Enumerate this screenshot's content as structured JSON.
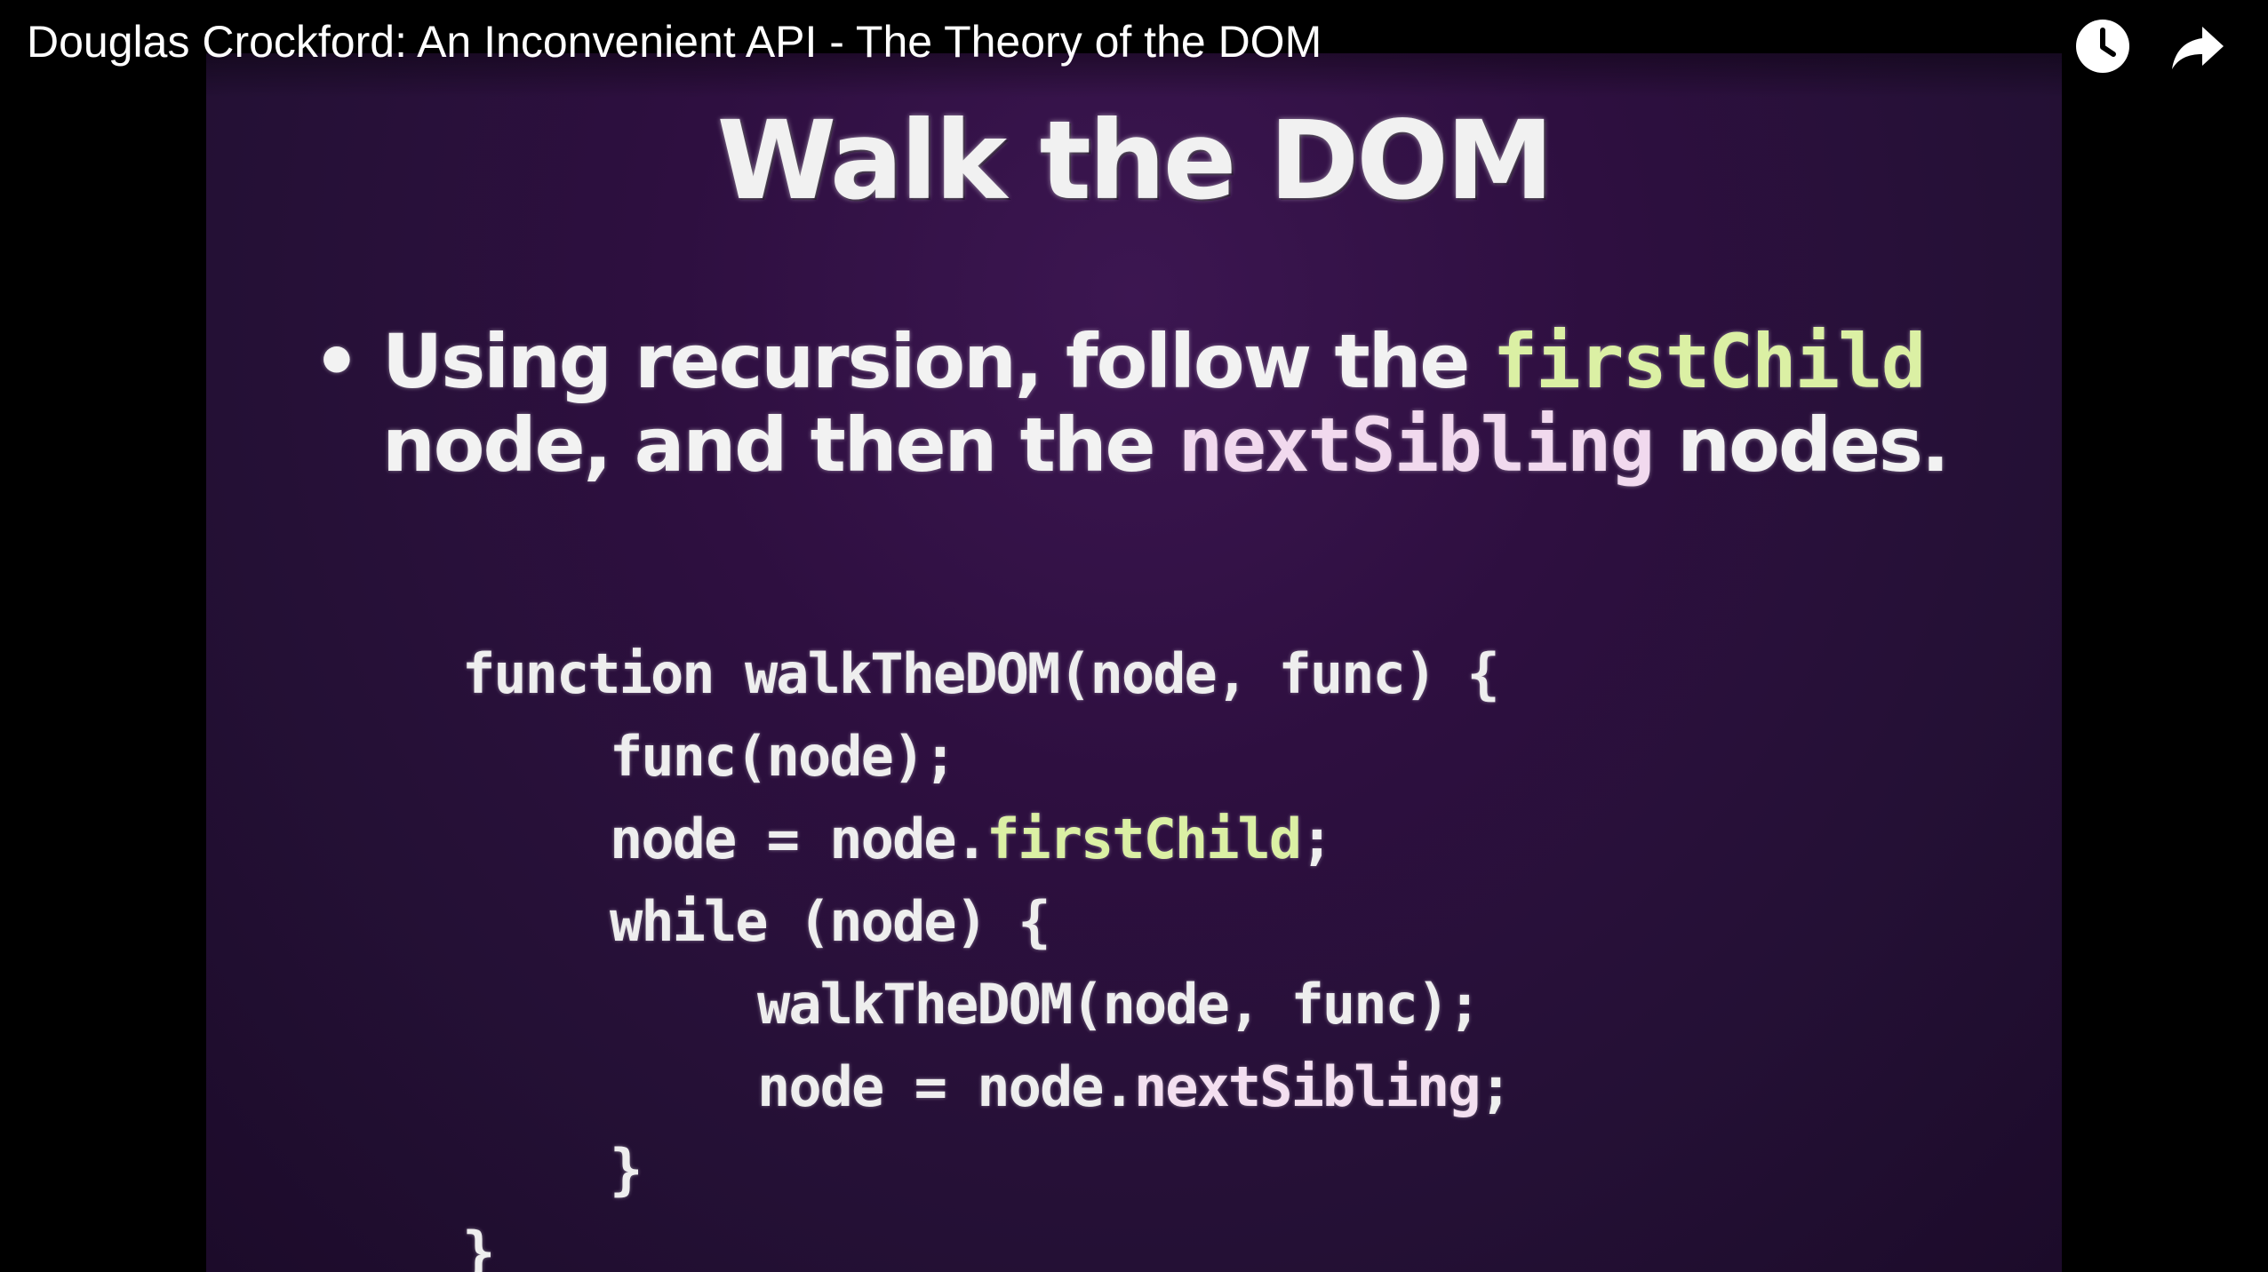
{
  "video": {
    "title": "Douglas Crockford: An Inconvenient API - The Theory of the DOM",
    "buttons": {
      "watch_later_icon": "clock-icon",
      "share_icon": "share-arrow-icon"
    }
  },
  "slide": {
    "title": "Walk the DOM",
    "bullet": {
      "marker": "•",
      "line1_prefix": "Using recursion, follow the ",
      "line1_code": "firstChild",
      "line2_prefix": "node, and then the ",
      "line2_code": "nextSibling",
      "line2_suffix": " nodes."
    },
    "code": {
      "line1": "function walkTheDOM(node, func) {",
      "line2": "func(node);",
      "line3_prefix": "node = node.",
      "line3_hl": "firstChild",
      "line3_suffix": ";",
      "line4": "while (node) {",
      "line5": "walkTheDOM(node, func);",
      "line6_prefix": "node = node.",
      "line6_hl": "nextSibling",
      "line6_suffix": ";",
      "line7": "}",
      "line8": "}"
    }
  },
  "colors": {
    "slide_bg": "#2e0f40",
    "highlight_green": "#dbf0a4",
    "highlight_pink": "#f1d9ee"
  }
}
